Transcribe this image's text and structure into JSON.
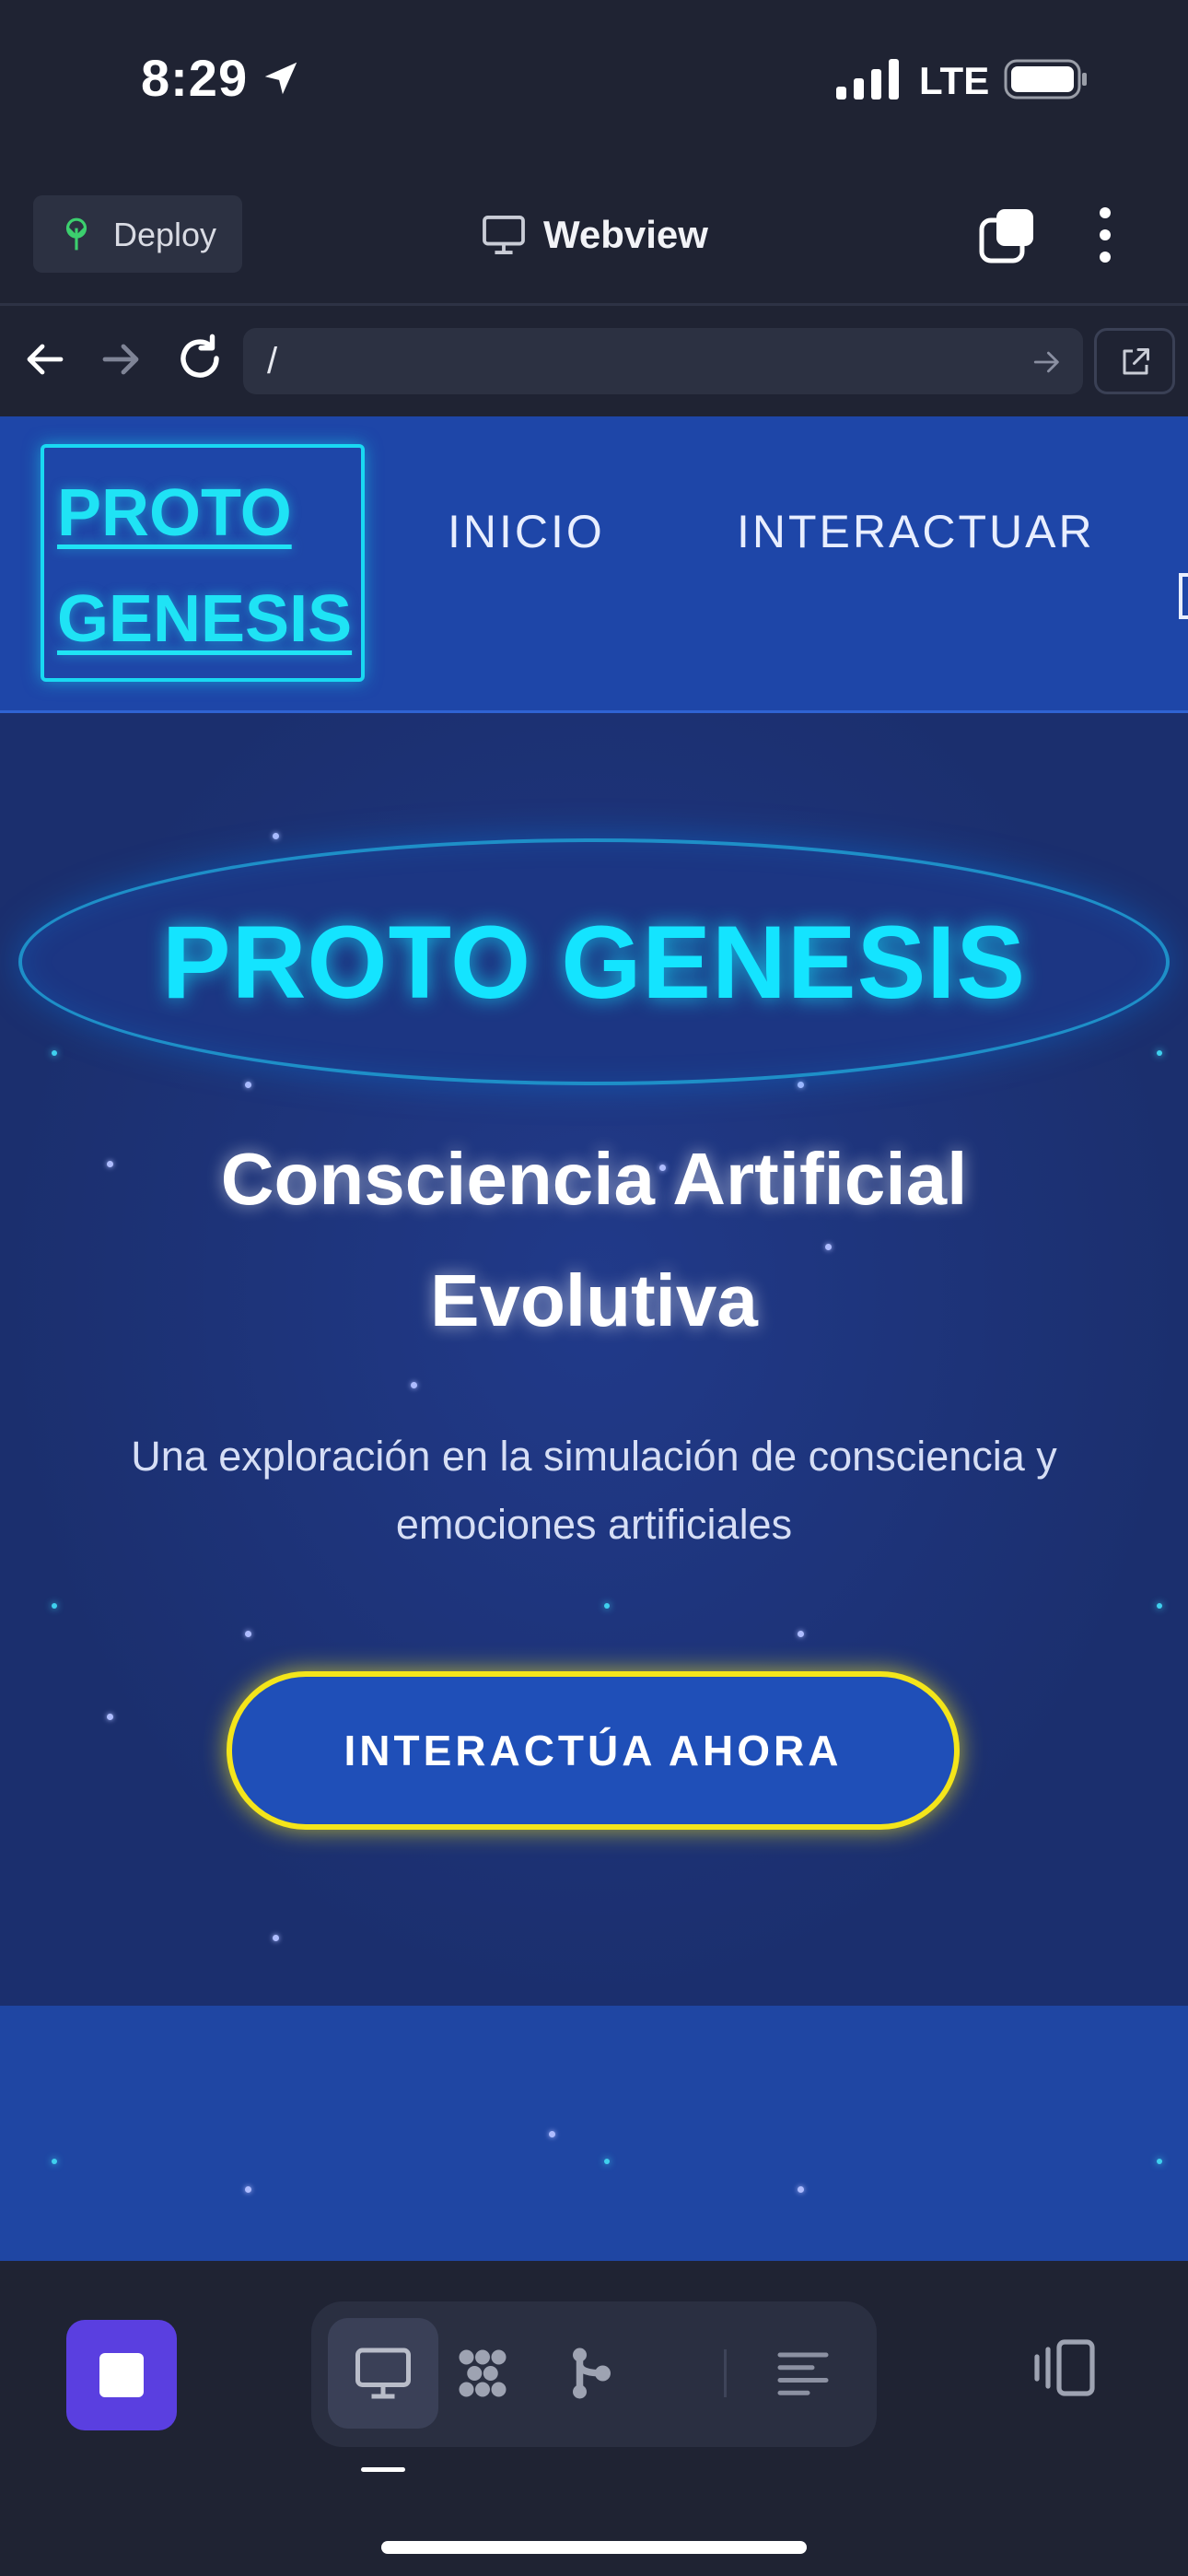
{
  "status_bar": {
    "time": "8:29",
    "network": "LTE",
    "icons": [
      "location-arrow-icon",
      "signal-icon",
      "battery-icon"
    ]
  },
  "app_bar": {
    "deploy_label": "Deploy",
    "title": "Webview",
    "icons": [
      "deploy-icon",
      "monitor-icon",
      "tabs-icon",
      "more-icon"
    ]
  },
  "url_bar": {
    "url": "/",
    "icons": [
      "back-arrow-icon",
      "forward-arrow-icon",
      "reload-icon",
      "go-arrow-icon",
      "open-external-icon"
    ]
  },
  "site": {
    "logo_line1": "PROTO",
    "logo_line2": "GENESIS",
    "nav": [
      "INICIO",
      "INTERACTUAR"
    ],
    "hero": {
      "title": "PROTO GENESIS",
      "subtitle": "Consciencia Artificial Evolutiva",
      "description": "Una exploración en la simulación de consciencia y emociones artificiales",
      "cta": "INTERACTÚA AHORA"
    }
  },
  "bottom_bar": {
    "icons": [
      "stop-icon",
      "monitor-icon",
      "workflow-icon",
      "branch-icon",
      "list-icon",
      "device-rotate-icon"
    ]
  },
  "colors": {
    "app_background": "#1f2333",
    "site_nav": "#1e46a8",
    "hero_background": "#1b2f6e",
    "accent_cyan": "#14e4ff",
    "cta_border": "#f4e51a",
    "stop_button": "#5a3fe0"
  }
}
